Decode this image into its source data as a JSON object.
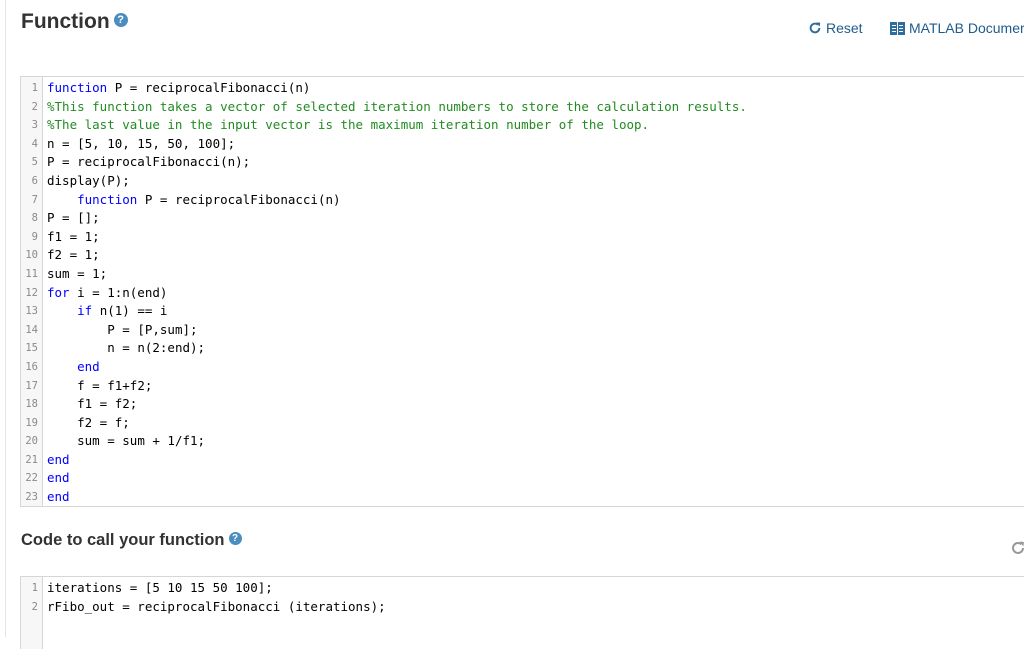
{
  "function_section": {
    "title": "Function",
    "help_icon": "question-circle-icon",
    "reset_label": "Reset",
    "reset_icon": "refresh-icon",
    "docs_label": "MATLAB Documer",
    "docs_icon": "book-icon",
    "lines": [
      {
        "num": "1",
        "indent": "",
        "kw": "function",
        "rest": " P = reciprocalFibonacci(n)",
        "type": "kwfirst"
      },
      {
        "num": "2",
        "indent": "",
        "text": "%This function takes a vector of selected iteration numbers to store the calculation results.",
        "type": "comment"
      },
      {
        "num": "3",
        "indent": "",
        "text": "%The last value in the input vector is the maximum iteration number of the loop.",
        "type": "comment"
      },
      {
        "num": "4",
        "indent": "",
        "text": "n = [5, 10, 15, 50, 100];",
        "type": "plain"
      },
      {
        "num": "5",
        "indent": "",
        "text": "P = reciprocalFibonacci(n);",
        "type": "plain"
      },
      {
        "num": "6",
        "indent": "",
        "text": "display(P);",
        "type": "plain"
      },
      {
        "num": "7",
        "indent": "    ",
        "kw": "function",
        "rest": " P = reciprocalFibonacci(n)",
        "type": "kwfirst"
      },
      {
        "num": "8",
        "indent": "",
        "text": "P = [];",
        "type": "plain"
      },
      {
        "num": "9",
        "indent": "",
        "text": "f1 = 1;",
        "type": "plain"
      },
      {
        "num": "10",
        "indent": "",
        "text": "f2 = 1;",
        "type": "plain"
      },
      {
        "num": "11",
        "indent": "",
        "text": "sum = 1;",
        "type": "plain"
      },
      {
        "num": "12",
        "indent": "",
        "kw": "for",
        "rest": " i = 1:n(end)",
        "type": "kwfirst"
      },
      {
        "num": "13",
        "indent": "    ",
        "kw": "if",
        "rest": " n(1) == i",
        "type": "kwfirst"
      },
      {
        "num": "14",
        "indent": "        ",
        "text": "P = [P,sum];",
        "type": "plain"
      },
      {
        "num": "15",
        "indent": "        ",
        "text": "n = n(2:end);",
        "type": "plain"
      },
      {
        "num": "16",
        "indent": "    ",
        "kw": "end",
        "rest": "",
        "type": "kwfirst"
      },
      {
        "num": "17",
        "indent": "    ",
        "text": "f = f1+f2;",
        "type": "plain"
      },
      {
        "num": "18",
        "indent": "    ",
        "text": "f1 = f2;",
        "type": "plain"
      },
      {
        "num": "19",
        "indent": "    ",
        "text": "f2 = f;",
        "type": "plain"
      },
      {
        "num": "20",
        "indent": "    ",
        "text": "sum = sum + 1/f1;",
        "type": "plain"
      },
      {
        "num": "21",
        "indent": "",
        "kw": "end",
        "rest": "",
        "type": "kwfirst"
      },
      {
        "num": "22",
        "indent": "",
        "kw": "end",
        "rest": "",
        "type": "kwfirst"
      },
      {
        "num": "23",
        "indent": "",
        "kw": "end",
        "rest": "",
        "type": "kwfirst"
      }
    ]
  },
  "call_section": {
    "title": "Code to call your function",
    "help_icon": "question-circle-icon",
    "reset_icon": "refresh-icon",
    "lines": [
      {
        "num": "1",
        "indent": "",
        "text": "iterations = [5 10 15 50 100];",
        "type": "plain"
      },
      {
        "num": "2",
        "indent": "",
        "text": "rFibo_out = reciprocalFibonacci (iterations);",
        "type": "plain"
      }
    ]
  },
  "colors": {
    "keyword": "#0000ff",
    "comment": "#228b22",
    "link": "#1f5c8c",
    "help_badge": "#4a8dbf"
  }
}
